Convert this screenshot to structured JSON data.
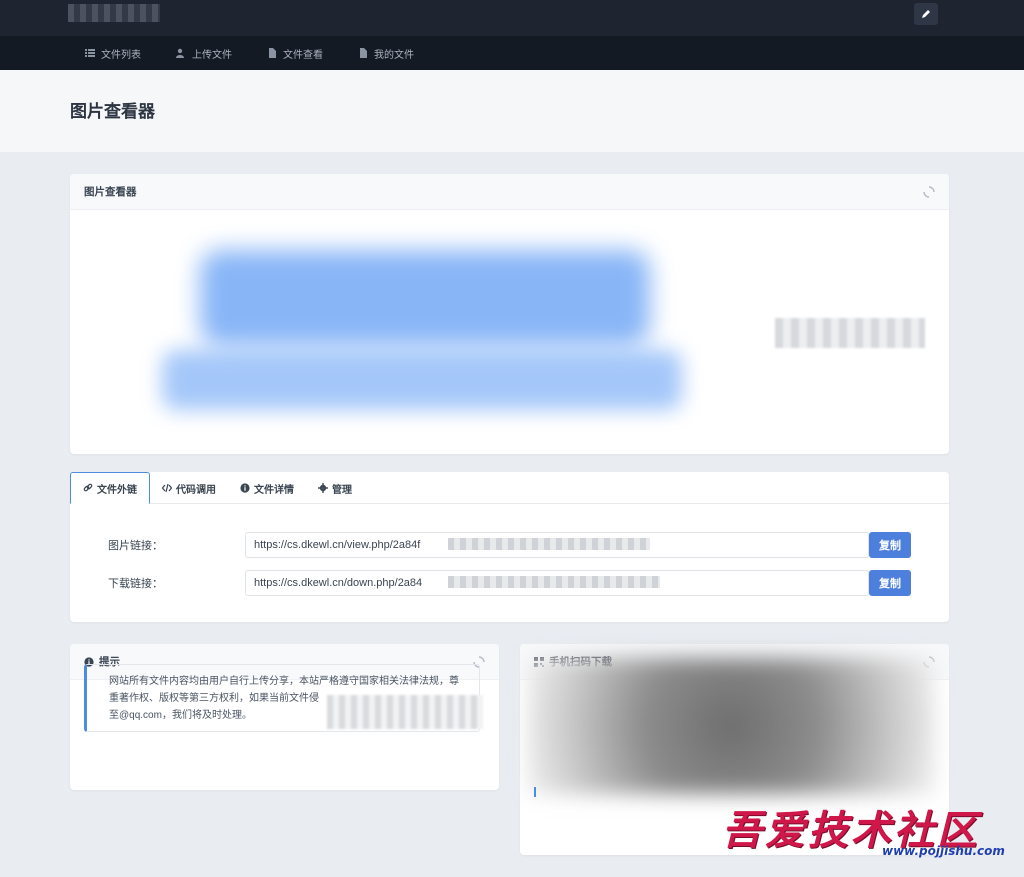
{
  "header": {
    "site_title": "",
    "edit_icon": "pencil-icon"
  },
  "nav": [
    {
      "label": "文件列表",
      "icon": "list-icon"
    },
    {
      "label": "上传文件",
      "icon": "user-upload-icon"
    },
    {
      "label": "文件查看",
      "icon": "file-icon"
    },
    {
      "label": "我的文件",
      "icon": "file-icon"
    }
  ],
  "page": {
    "title": "图片查看器"
  },
  "viewer": {
    "title": "图片查看器"
  },
  "tabs": [
    {
      "label": "文件外链",
      "icon": "link-icon",
      "active": true
    },
    {
      "label": "代码调用",
      "icon": "code-icon",
      "active": false
    },
    {
      "label": "文件详情",
      "icon": "info-icon",
      "active": false
    },
    {
      "label": "管理",
      "icon": "gear-icon",
      "active": false
    }
  ],
  "links": {
    "image_label": "图片链接：",
    "image_value": "https://cs.dkewl.cn/view.php/2a84f",
    "download_label": "下载链接：",
    "download_value": "https://cs.dkewl.cn/down.php/2a84",
    "copy_label": "复制"
  },
  "notice": {
    "title": "提示",
    "line1": "网站所有文件内容均由用户自行上传分享，本站严格遵守国家相关法律法规，尊",
    "line2": "重著作权、版权等第三方权利，如果当前文件侵",
    "line3": "至@qq.com，我们将及时处理。"
  },
  "qr": {
    "title": "手机扫码下载"
  },
  "watermark": {
    "title": "吾爱技术社区",
    "url": "www.pojjishu.com"
  },
  "colors": {
    "accent": "#4d7fdc",
    "topbar": "#1e2430",
    "navbar": "#141a24"
  }
}
